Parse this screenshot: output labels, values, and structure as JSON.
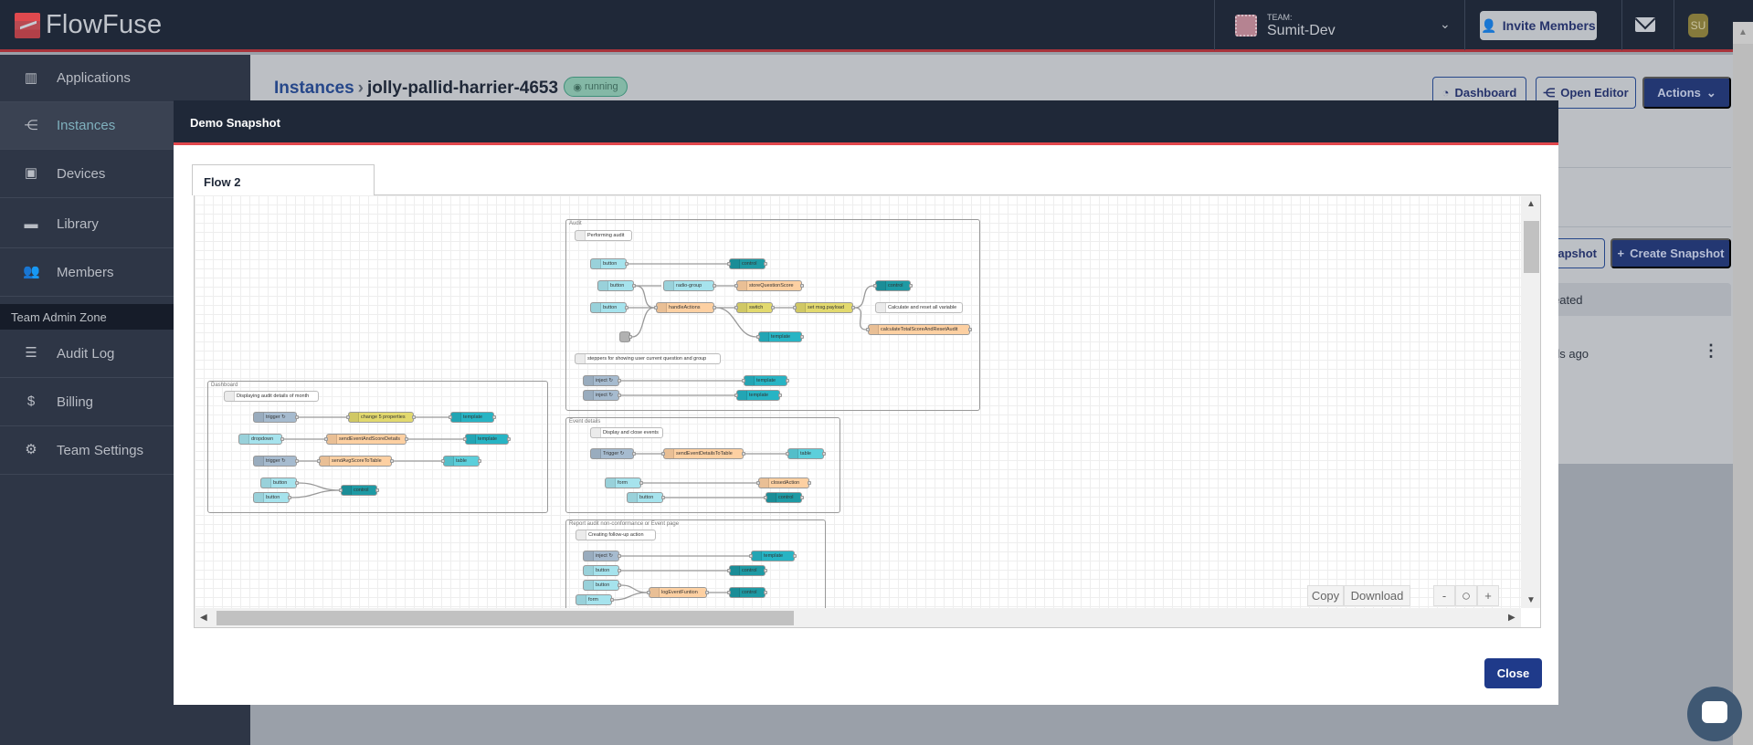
{
  "app": {
    "brand": "FlowFuse",
    "team_label": "TEAM:",
    "team_name": "Sumit-Dev",
    "invite_label": "Invite Members",
    "avatar_initials": "SU"
  },
  "sidebar": {
    "items": [
      {
        "label": "Applications",
        "icon": "applications-icon"
      },
      {
        "label": "Instances",
        "icon": "instances-icon",
        "active": true
      },
      {
        "label": "Devices",
        "icon": "chip-icon"
      },
      {
        "label": "Library",
        "icon": "folder-icon"
      },
      {
        "label": "Members",
        "icon": "users-icon"
      }
    ],
    "zone_label": "Team Admin Zone",
    "admin_items": [
      {
        "label": "Audit Log",
        "icon": "database-icon"
      },
      {
        "label": "Billing",
        "icon": "dollar-icon"
      },
      {
        "label": "Team Settings",
        "icon": "gear-icon"
      }
    ]
  },
  "page": {
    "breadcrumb_root": "Instances",
    "instance_name": "jolly-pallid-harrier-4653",
    "status": "running",
    "dashboard_label": "Dashboard",
    "open_editor_label": "Open Editor",
    "actions_label": "Actions",
    "partial_snapshot_label": "apshot",
    "create_snapshot_label": "Create Snapshot",
    "table_header_partial": "eated",
    "row_time_partial": "ds ago"
  },
  "modal": {
    "title": "Demo Snapshot",
    "tab": "Flow 2",
    "copy_label": "Copy",
    "download_label": "Download",
    "zoom_out": "-",
    "zoom_reset": "○",
    "zoom_in": "+",
    "close_label": "Close"
  },
  "flow": {
    "groups": [
      "Audit",
      "Dashboard",
      "Event details",
      "Report audit non-conformance or Event page"
    ],
    "nodes": [
      {
        "label": "Performing audit",
        "type": "comment"
      },
      {
        "label": "button",
        "type": "ui-input"
      },
      {
        "label": "control",
        "type": "ui-control"
      },
      {
        "label": "button",
        "type": "ui-input"
      },
      {
        "label": "radio-group",
        "type": "ui-input"
      },
      {
        "label": "storeQuestionScore",
        "type": "function"
      },
      {
        "label": "control",
        "type": "ui-control"
      },
      {
        "label": "button",
        "type": "ui-input"
      },
      {
        "label": "handleActions",
        "type": "function"
      },
      {
        "label": "switch",
        "type": "switch"
      },
      {
        "label": "set msg.payload",
        "type": "switch"
      },
      {
        "label": "Calculate and reset all variable",
        "type": "comment"
      },
      {
        "label": "template",
        "type": "ui-template"
      },
      {
        "label": "calculateTotalScoreAndResetAudit",
        "type": "function"
      },
      {
        "label": "",
        "type": "status"
      },
      {
        "label": "steppers for showing user current question and group",
        "type": "comment"
      },
      {
        "label": "inject ↻",
        "type": "inject"
      },
      {
        "label": "template",
        "type": "ui-template"
      },
      {
        "label": "inject ↻",
        "type": "inject"
      },
      {
        "label": "template",
        "type": "ui-template"
      },
      {
        "label": "Displaying audit details of month",
        "type": "comment"
      },
      {
        "label": "trigger ↻",
        "type": "inject"
      },
      {
        "label": "change 5 properties",
        "type": "switch"
      },
      {
        "label": "template",
        "type": "ui-template"
      },
      {
        "label": "dropdown",
        "type": "ui-input"
      },
      {
        "label": "sendEventAndScoreDetails",
        "type": "function"
      },
      {
        "label": "template",
        "type": "ui-template"
      },
      {
        "label": "trigger ↻",
        "type": "inject"
      },
      {
        "label": "sendAvgScoreToTable",
        "type": "function"
      },
      {
        "label": "table",
        "type": "ui-table"
      },
      {
        "label": "button",
        "type": "ui-input"
      },
      {
        "label": "button",
        "type": "ui-input"
      },
      {
        "label": "control",
        "type": "ui-control"
      },
      {
        "label": "Display and close events",
        "type": "comment"
      },
      {
        "label": "Trigger ↻",
        "type": "inject"
      },
      {
        "label": "sendEventDetailsToTable",
        "type": "function"
      },
      {
        "label": "table",
        "type": "ui-table"
      },
      {
        "label": "form",
        "type": "ui-input"
      },
      {
        "label": "closedAction",
        "type": "function"
      },
      {
        "label": "button",
        "type": "ui-input"
      },
      {
        "label": "control",
        "type": "ui-control"
      },
      {
        "label": "Creating follow-up action",
        "type": "comment"
      },
      {
        "label": "inject ↻",
        "type": "inject"
      },
      {
        "label": "template",
        "type": "ui-template"
      },
      {
        "label": "button",
        "type": "ui-input"
      },
      {
        "label": "control",
        "type": "ui-control"
      },
      {
        "label": "button",
        "type": "ui-input"
      },
      {
        "label": "logEventFuntion",
        "type": "function"
      },
      {
        "label": "control",
        "type": "ui-control"
      },
      {
        "label": "form",
        "type": "ui-input"
      }
    ],
    "colors": {
      "comment": "#ffffff",
      "ui-input": "#a6e3ed",
      "ui-control": "#1e9aa4",
      "ui-template": "#27b4c4",
      "ui-table": "#5ccfdb",
      "function": "#fdd0a2",
      "switch": "#e2d96e",
      "inject": "#a6bbcf",
      "status": "#c0c0c0"
    }
  },
  "colors": {
    "header": "#1f2838",
    "accent_red": "#e2474c",
    "primary": "#1f3a8a",
    "sidebar": "#2e3646"
  }
}
